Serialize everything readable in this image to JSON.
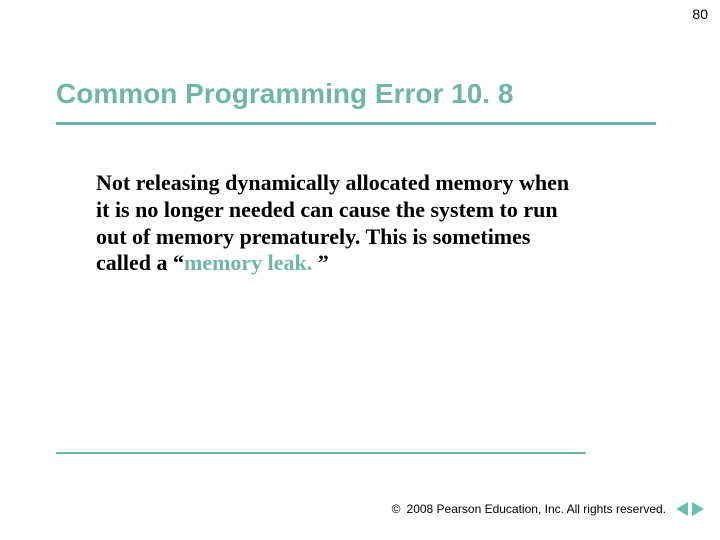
{
  "page_number": "80",
  "heading": "Common Programming Error 10. 8",
  "body": {
    "part1": "Not releasing dynamically allocated memory when it is no longer needed can cause the system to run out of memory prematurely. This is sometimes called a ",
    "quote_open": "“",
    "term": "memory leak.",
    "quote_close": " ”"
  },
  "footer": {
    "copyright_symbol": "©",
    "text": "2008 Pearson Education, Inc.  All rights reserved."
  }
}
